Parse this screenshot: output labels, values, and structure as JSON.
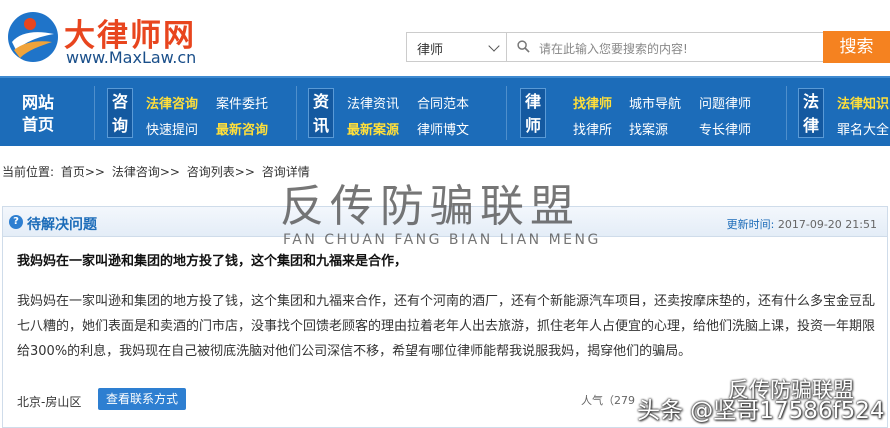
{
  "site": {
    "logo_cn": "大律师网",
    "logo_en": "www.MaxLaw.cn"
  },
  "search": {
    "category": "律师",
    "placeholder": "请在此输入您要搜索的内容!",
    "button": "搜索"
  },
  "nav": {
    "home_line1": "网站",
    "home_line2": "首页",
    "groups": [
      {
        "tag1": "咨",
        "tag2": "询",
        "links": [
          "法律咨询",
          "案件委托",
          "快速提问",
          "最新咨询"
        ]
      },
      {
        "tag1": "资",
        "tag2": "讯",
        "links": [
          "法律资讯",
          "合同范本",
          "最新案源",
          "律师博文"
        ]
      },
      {
        "tag1": "律",
        "tag2": "师",
        "links": [
          "找律师",
          "城市导航",
          "问题律师",
          "找律所",
          "找案源",
          "专长律师"
        ]
      },
      {
        "tag1": "法",
        "tag2": "律",
        "links": [
          "法律知识",
          "罪名大全"
        ]
      }
    ]
  },
  "breadcrumb": {
    "prefix": "当前位置:",
    "items": [
      "首页>>",
      "法律咨询>>",
      "咨询列表>>",
      "咨询详情"
    ]
  },
  "question": {
    "status": "待解决问题",
    "updated_label": "更新时间:",
    "updated_time": "2017-09-20 21:51",
    "title": "我妈妈在一家叫逊和集团的地方投了钱，这个集团和九福来是合作，",
    "body": "我妈妈在一家叫逊和集团的地方投了钱，这个集团和九福来合作，还有个河南的酒厂，还有个新能源汽车项目，还卖按摩床垫的，还有什么多宝金豆乱七八糟的，她们表面是和卖酒的门市店，没事找个回馈老顾客的理由拉着老年人出去旅游，抓住老年人占便宜的心理，给他们洗脑上课，投资一年期限给300%的利息，我妈现在自己被彻底洗脑对他们公司深信不移，希望有哪位律师能帮我说服我妈，揭穿他们的骗局。",
    "location": "北京-房山区",
    "contact_button": "查看联系方式",
    "popularity": "人气（279"
  },
  "watermarks": {
    "cn": "反传防骗联盟",
    "en": "FAN CHUAN FANG BIAN LIAN MENG",
    "wechat": "反传防骗联盟",
    "toutiao": "头条 @坚哥17586f524"
  },
  "colors": {
    "nav_bg": "#1c6cb9",
    "accent_orange": "#f58220",
    "logo_red": "#e8451e",
    "highlight_yellow": "#ffdf3a"
  }
}
